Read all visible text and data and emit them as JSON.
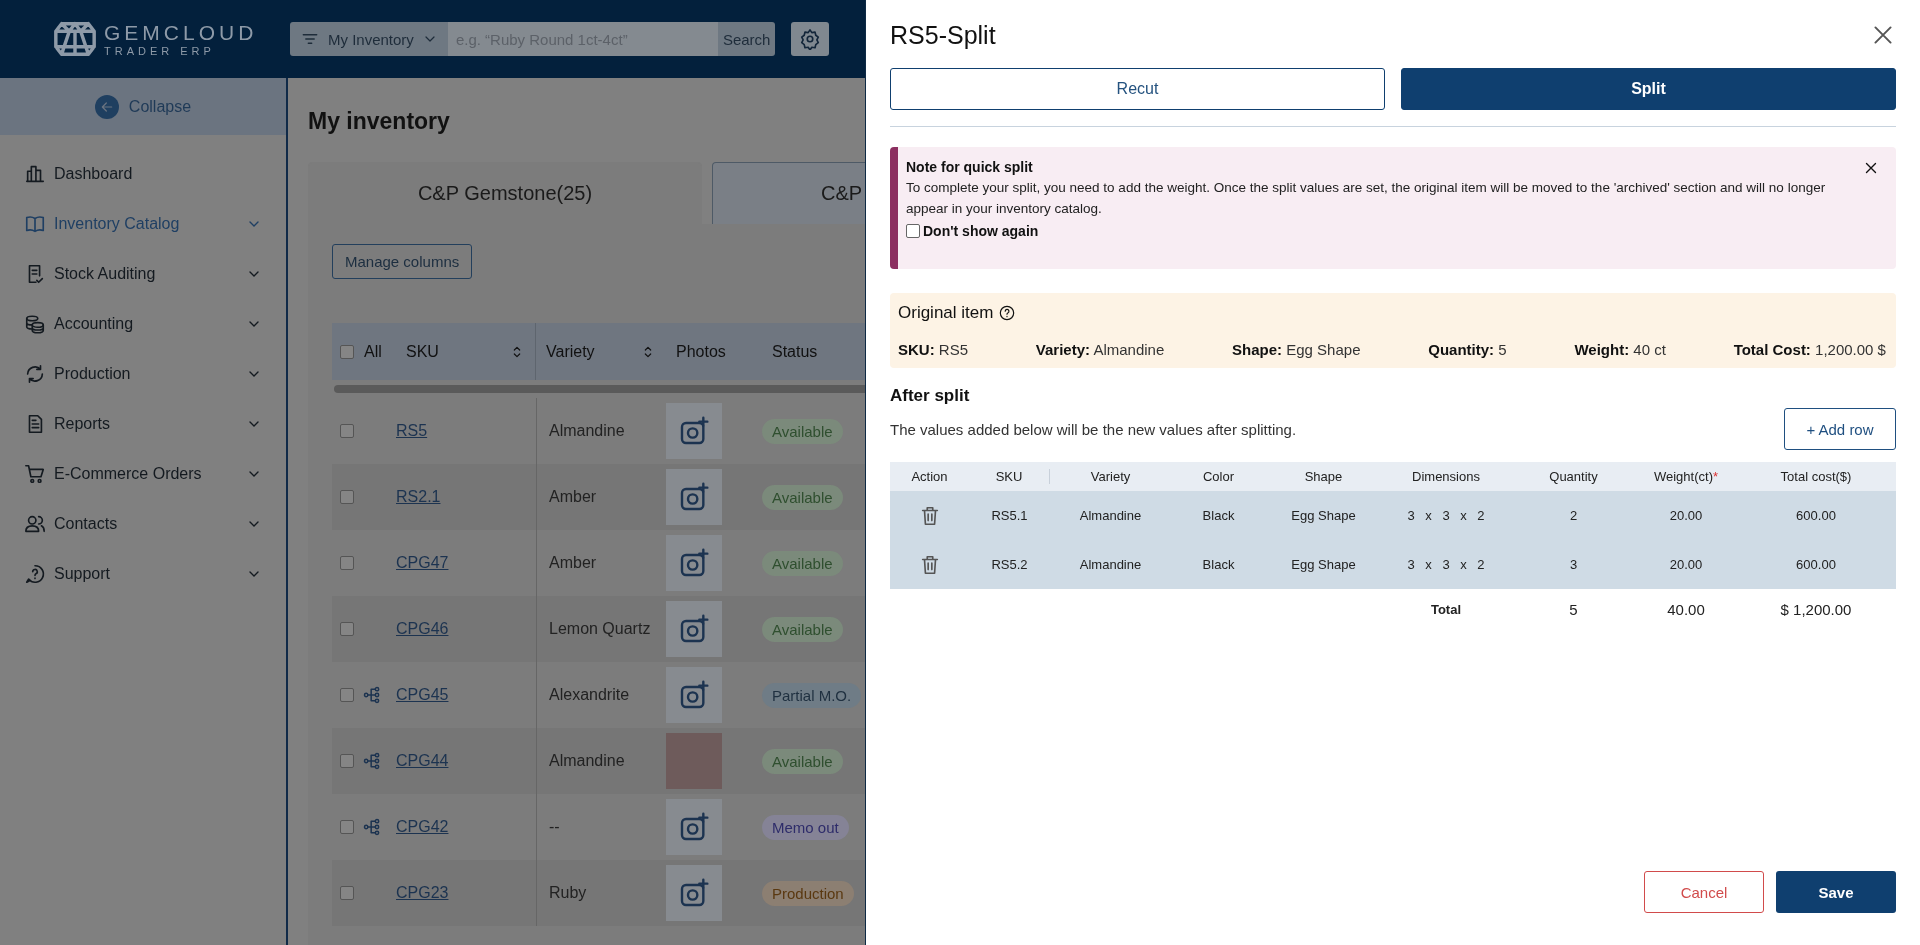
{
  "header": {
    "logo_title": "GEMCLOUD",
    "logo_subtitle": "TRADER ERP",
    "filter": "My Inventory",
    "search_placeholder": "e.g. “Ruby Round 1ct-4ct”",
    "search_button": "Search"
  },
  "sidebar": {
    "collapse": "Collapse",
    "items": [
      {
        "label": "Dashboard",
        "selected": false,
        "has_submenu": false
      },
      {
        "label": "Inventory Catalog",
        "selected": true,
        "has_submenu": true
      },
      {
        "label": "Stock Auditing",
        "selected": false,
        "has_submenu": true
      },
      {
        "label": "Accounting",
        "selected": false,
        "has_submenu": true
      },
      {
        "label": "Production",
        "selected": false,
        "has_submenu": true
      },
      {
        "label": "Reports",
        "selected": false,
        "has_submenu": true
      },
      {
        "label": "E-Commerce Orders",
        "selected": false,
        "has_submenu": true
      },
      {
        "label": "Contacts",
        "selected": false,
        "has_submenu": true
      },
      {
        "label": "Support",
        "selected": false,
        "has_submenu": true
      }
    ]
  },
  "page": {
    "title": "My inventory",
    "tabs": [
      {
        "label": "C&P Gemstone(25)",
        "selected": true
      },
      {
        "label": "C&P",
        "selected": false
      }
    ],
    "manage_columns": "Manage columns"
  },
  "table": {
    "select_all": "All",
    "select_all_checked": false,
    "columns": [
      "SKU",
      "Variety",
      "Photos",
      "Status"
    ],
    "rows": [
      {
        "checked": false,
        "hierarchy": false,
        "sku": "RS5",
        "variety": "Almandine",
        "photo": false,
        "status": "Available",
        "color": "#7b8a7b"
      },
      {
        "checked": false,
        "hierarchy": false,
        "sku": "RS2.1",
        "variety": "Amber",
        "photo": false,
        "status": "Available",
        "color": "#7b8a7b"
      },
      {
        "checked": false,
        "hierarchy": false,
        "sku": "CPG47",
        "variety": "Amber",
        "photo": false,
        "status": "Available",
        "color": "#7b8a7b"
      },
      {
        "checked": false,
        "hierarchy": false,
        "sku": "CPG46",
        "variety": "Lemon Quartz",
        "photo": false,
        "status": "Available",
        "color": "#7b8a7b"
      },
      {
        "checked": false,
        "hierarchy": true,
        "sku": "CPG45",
        "variety": "Alexandrite",
        "photo": false,
        "status": "Partial M.O.",
        "color": "#6f7c86"
      },
      {
        "checked": false,
        "hierarchy": true,
        "sku": "CPG44",
        "variety": "Almandine",
        "photo": true,
        "status": "Available",
        "color": "#7b8a7b"
      },
      {
        "checked": false,
        "hierarchy": true,
        "sku": "CPG42",
        "variety": "--",
        "photo": false,
        "status": "Memo out",
        "color": "#858396"
      },
      {
        "checked": false,
        "hierarchy": false,
        "sku": "CPG23",
        "variety": "Ruby",
        "photo": false,
        "status": "Production",
        "color": "#8c7f72"
      }
    ]
  },
  "modal": {
    "title": "RS5-Split",
    "tabs": [
      {
        "label": "Recut",
        "selected": false
      },
      {
        "label": "Split",
        "selected": true
      }
    ],
    "note": {
      "title": "Note for quick split",
      "text": "To complete your split, you need to add the weight. Once the split values are set, the original item will be moved to the 'archived' section and will no longer appear in your inventory catalog.",
      "checkbox_label": "Don't show again",
      "checked": false
    },
    "original_item": {
      "title": "Original item",
      "fields": [
        {
          "label": "SKU:",
          "value": "RS5"
        },
        {
          "label": "Variety:",
          "value": "Almandine"
        },
        {
          "label": "Shape:",
          "value": "Egg Shape"
        },
        {
          "label": "Quantity:",
          "value": "5"
        },
        {
          "label": "Weight:",
          "value": "40 ct"
        },
        {
          "label": "Total Cost:",
          "value": "1,200.00 $"
        }
      ]
    },
    "after_split": {
      "title": "After split",
      "description": "The values added below will be the new values after splitting.",
      "add_row": "+ Add row",
      "columns": [
        {
          "label": "Action"
        },
        {
          "label": "SKU"
        },
        {
          "label": "Variety"
        },
        {
          "label": "Color"
        },
        {
          "label": "Shape"
        },
        {
          "label": "Dimensions"
        },
        {
          "label": "Quantity"
        },
        {
          "label": "Weight(ct)",
          "mark": "*"
        },
        {
          "label": "Total cost($)"
        }
      ],
      "rows": [
        {
          "sku": "RS5.1",
          "variety": "Almandine",
          "stone_color": "Black",
          "shape": "Egg Shape",
          "dimensions": "3 x 3 x 2",
          "quantity": "2",
          "weight": "20.00",
          "total_cost": "600.00"
        },
        {
          "sku": "RS5.2",
          "variety": "Almandine",
          "stone_color": "Black",
          "shape": "Egg Shape",
          "dimensions": "3 x 3 x 2",
          "quantity": "3",
          "weight": "20.00",
          "total_cost": "600.00"
        }
      ],
      "total": {
        "label": "Total",
        "quantity": "5",
        "weight": "40.00",
        "total_cost": "$ 1,200.00"
      }
    },
    "buttons": {
      "cancel": "Cancel",
      "save": "Save"
    }
  }
}
